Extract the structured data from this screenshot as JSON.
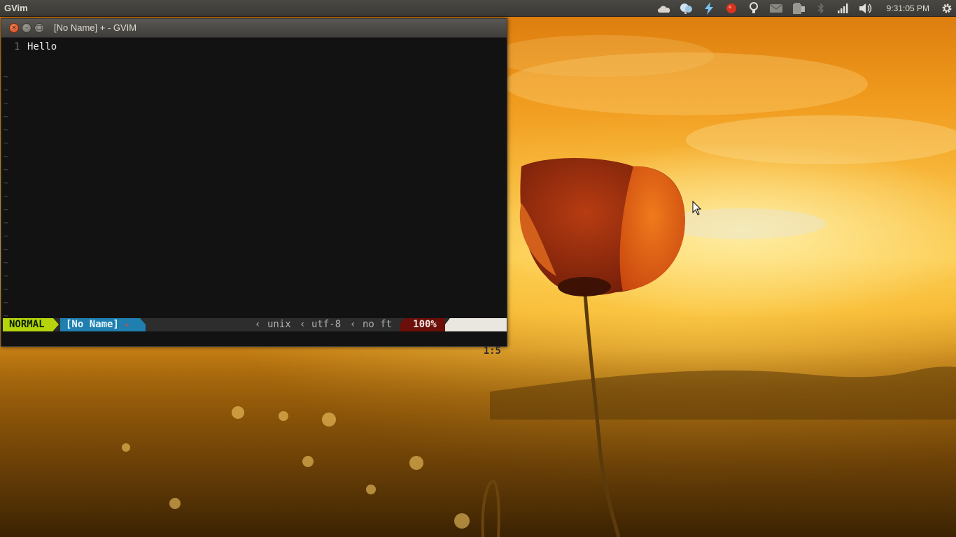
{
  "panel": {
    "app_title": "GVim",
    "clock": "9:31:05 PM",
    "indicators": [
      "cloud-icon",
      "chat-bubbles-icon",
      "lightning-icon",
      "record-icon",
      "bulb-icon",
      "mail-icon",
      "battery-icon",
      "bluetooth-icon",
      "network-signal-icon",
      "volume-icon",
      "gear-icon"
    ]
  },
  "window": {
    "title": "[No Name] + - GVIM",
    "buttons": {
      "close": "×",
      "minimize": "–",
      "maximize": "□"
    }
  },
  "editor": {
    "lines": [
      {
        "number": "1",
        "text": "Hello"
      }
    ],
    "tilde": "~"
  },
  "statusline": {
    "mode": "NORMAL",
    "filename": "[No Name]",
    "modified": "+",
    "fileformat": "unix",
    "encoding": "utf-8",
    "filetype": "no ft",
    "percent": "100%",
    "line_symbol": "␤",
    "position": "1:5"
  },
  "colors": {
    "mode_bg": "#b5d40c",
    "filename_bg": "#1f7fae",
    "percent_bg": "#6b0f0a",
    "position_bg": "#e9e7df",
    "editor_bg": "#121212"
  }
}
